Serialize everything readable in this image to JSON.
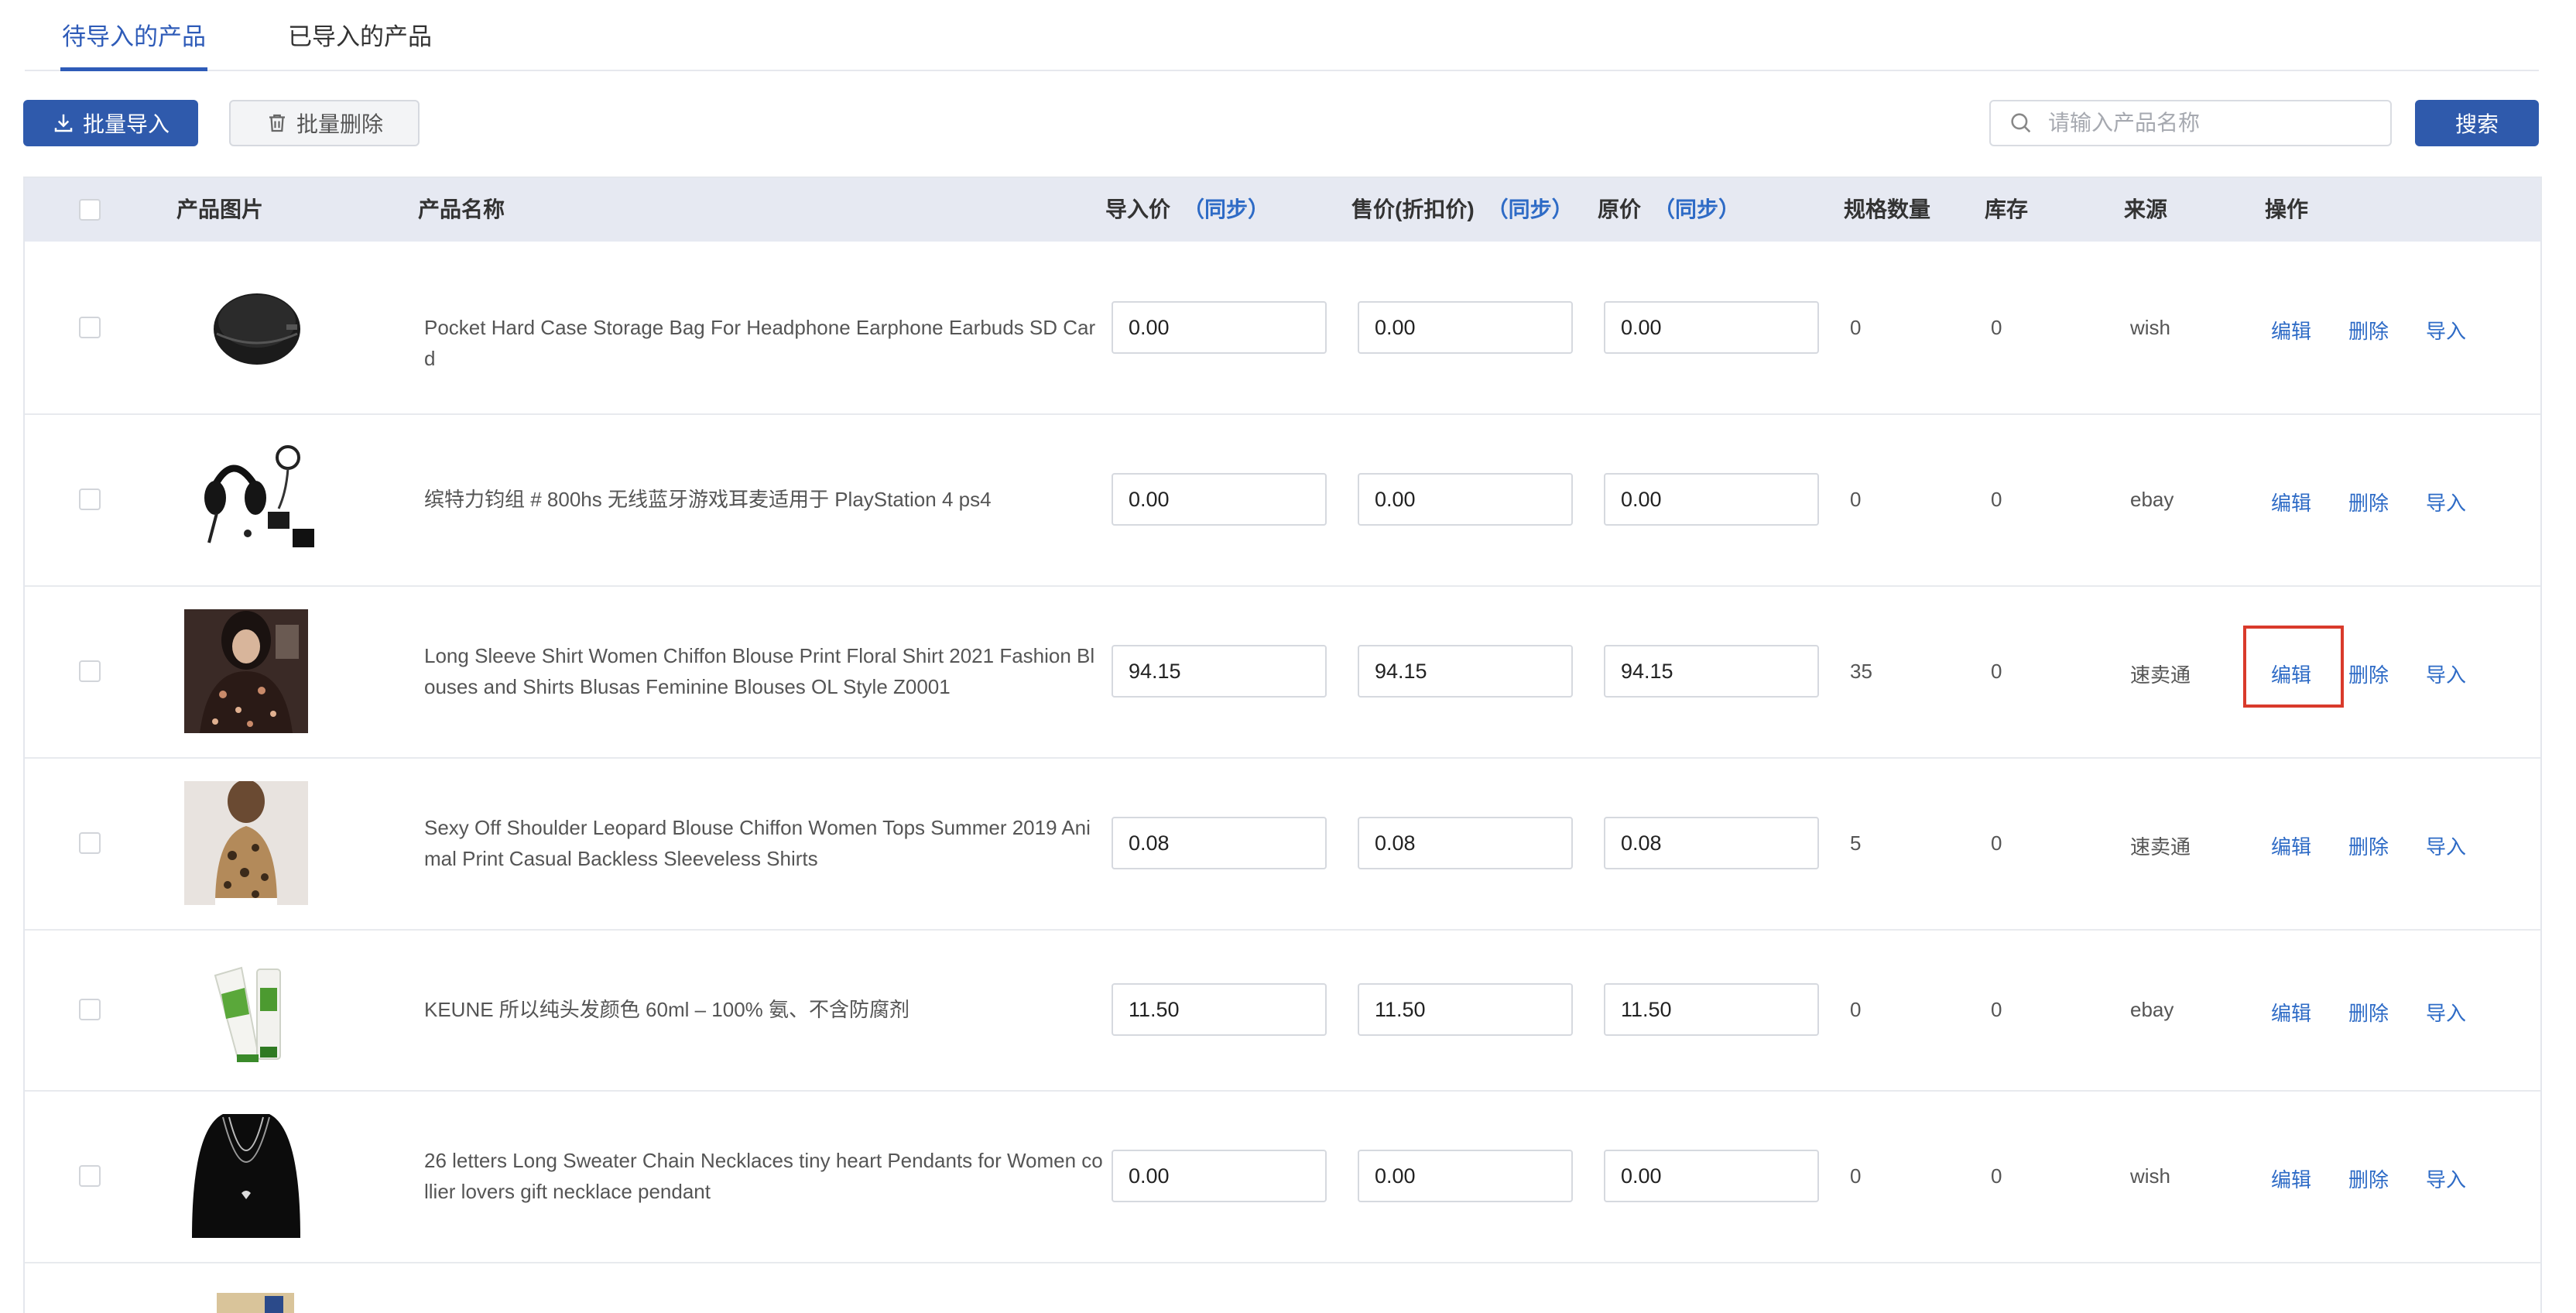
{
  "tabs": [
    {
      "label": "待导入的产品",
      "active": true
    },
    {
      "label": "已导入的产品",
      "active": false
    }
  ],
  "toolbar": {
    "batch_import": "批量导入",
    "batch_delete": "批量删除",
    "search_placeholder": "请输入产品名称",
    "search_button": "搜索"
  },
  "table": {
    "headers": {
      "image": "产品图片",
      "name": "产品名称",
      "import_price": "导入价",
      "sale_price": "售价(折扣价)",
      "original_price": "原价",
      "sync": "（同步）",
      "spec_count": "规格数量",
      "stock": "库存",
      "source": "来源",
      "actions": "操作"
    },
    "actions": {
      "edit": "编辑",
      "delete": "删除",
      "import": "导入"
    },
    "rows": [
      {
        "name": "Pocket Hard Case Storage Bag For Headphone Earphone Earbuds SD Card",
        "import_price": "0.00",
        "sale_price": "0.00",
        "original_price": "0.00",
        "spec_count": "0",
        "stock": "0",
        "source": "wish",
        "image": "black-zip-case"
      },
      {
        "name": "缤特力钧组 # 800hs 无线蓝牙游戏耳麦适用于 PlayStation 4 ps4",
        "import_price": "0.00",
        "sale_price": "0.00",
        "original_price": "0.00",
        "spec_count": "0",
        "stock": "0",
        "source": "ebay",
        "image": "gaming-headset"
      },
      {
        "name": "Long Sleeve Shirt Women Chiffon Blouse Print Floral Shirt 2021 Fashion Blouses and Shirts Blusas Feminine Blouses OL Style Z0001",
        "import_price": "94.15",
        "sale_price": "94.15",
        "original_price": "94.15",
        "spec_count": "35",
        "stock": "0",
        "source": "速卖通",
        "image": "floral-blouse"
      },
      {
        "name": "Sexy Off Shoulder Leopard Blouse Chiffon Women Tops Summer 2019 Animal Print Casual Backless Sleeveless Shirts",
        "import_price": "0.08",
        "sale_price": "0.08",
        "original_price": "0.08",
        "spec_count": "5",
        "stock": "0",
        "source": "速卖通",
        "image": "leopard-top"
      },
      {
        "name": "KEUNE 所以纯头发颜色 60ml – 100% 氨、不含防腐剂",
        "import_price": "11.50",
        "sale_price": "11.50",
        "original_price": "11.50",
        "spec_count": "0",
        "stock": "0",
        "source": "ebay",
        "image": "hair-color-tube"
      },
      {
        "name": "26 letters Long Sweater Chain Necklaces tiny heart Pendants for Women collier lovers gift necklace pendant",
        "import_price": "0.00",
        "sale_price": "0.00",
        "original_price": "0.00",
        "spec_count": "0",
        "stock": "0",
        "source": "wish",
        "image": "necklace"
      }
    ]
  },
  "colors": {
    "accent": "#2e5bb8",
    "link": "#2e6bc6",
    "highlight": "#d93a2b",
    "header_bg": "#e6e9f2"
  }
}
